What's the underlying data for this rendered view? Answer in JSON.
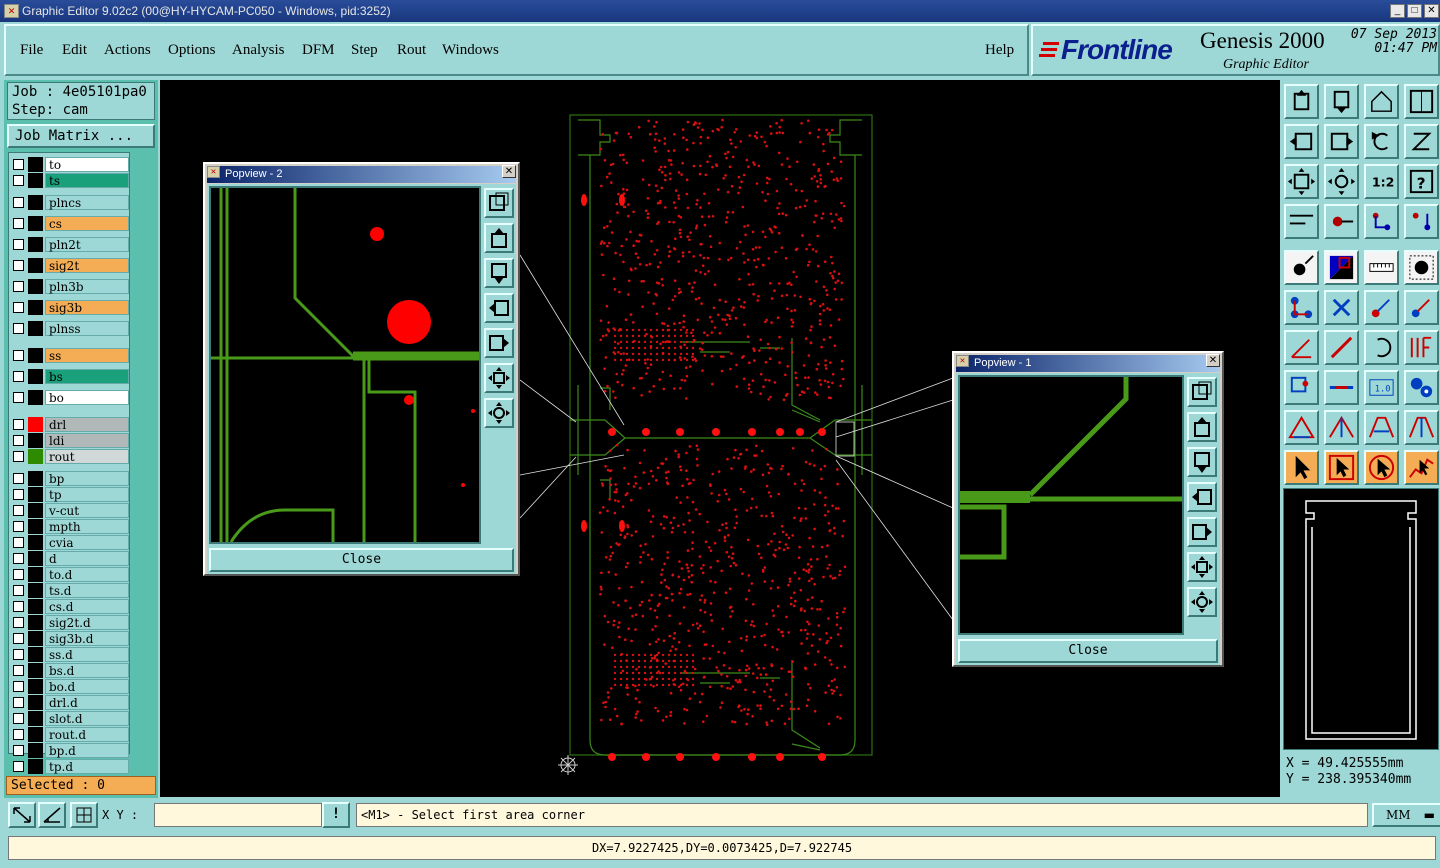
{
  "window": {
    "title": "Graphic Editor 9.02c2 (00@HY-HYCAM-PC050 - Windows, pid:3252)",
    "min_label": "_",
    "max_label": "□",
    "close_label": "✕"
  },
  "menu": [
    "File",
    "Edit",
    "Actions",
    "Options",
    "Analysis",
    "DFM",
    "Step",
    "Rout",
    "Windows"
  ],
  "help_label": "Help",
  "logo": {
    "brand": "Frontline",
    "product": "Genesis 2000",
    "subtitle": "Graphic Editor",
    "date": "07 Sep 2013",
    "time": "01:47 PM"
  },
  "job": {
    "job_line": "Job : 4e05101pa0",
    "step_line": "Step: cam",
    "matrix_label": "Job Matrix ..."
  },
  "layers": [
    {
      "name": "to",
      "color": "#ffffff",
      "swatch": "#000000",
      "group": 1
    },
    {
      "name": "ts",
      "color": "#1aa07a",
      "swatch": "#000000",
      "group": 1
    },
    {
      "name": "plncs",
      "color": "#9ed8d6",
      "swatch": "#000000",
      "group": 2
    },
    {
      "name": "cs",
      "color": "#f4ac55",
      "swatch": "#000000",
      "group": 2
    },
    {
      "name": "pln2t",
      "color": "#9ed8d6",
      "swatch": "#000000",
      "group": 2
    },
    {
      "name": "sig2t",
      "color": "#f4ac55",
      "swatch": "#000000",
      "group": 2
    },
    {
      "name": "pln3b",
      "color": "#9ed8d6",
      "swatch": "#000000",
      "group": 2
    },
    {
      "name": "sig3b",
      "color": "#f4ac55",
      "swatch": "#000000",
      "group": 2
    },
    {
      "name": "plnss",
      "color": "#9ed8d6",
      "swatch": "#000000",
      "group": 2
    },
    {
      "name": "ss",
      "color": "#f4ac55",
      "swatch": "#000000",
      "group": 3
    },
    {
      "name": "bs",
      "color": "#1aa07a",
      "swatch": "#000000",
      "group": 3
    },
    {
      "name": "bo",
      "color": "#ffffff",
      "swatch": "#000000",
      "group": 3
    },
    {
      "name": "drl",
      "color": "#b0b8b8",
      "swatch": "#ff0000",
      "group": 4
    },
    {
      "name": "ldi",
      "color": "#b0b8b8",
      "swatch": "#000000",
      "group": 4
    },
    {
      "name": "rout",
      "color": "#d0d8d8",
      "swatch": "#2e8b00",
      "group": 4
    },
    {
      "name": "bp",
      "color": "#9ed8d6",
      "swatch": "#000000",
      "group": 5
    },
    {
      "name": "tp",
      "color": "#9ed8d6",
      "swatch": "#000000",
      "group": 5
    },
    {
      "name": "v-cut",
      "color": "#9ed8d6",
      "swatch": "#000000",
      "group": 5
    },
    {
      "name": "mpth",
      "color": "#9ed8d6",
      "swatch": "#000000",
      "group": 5
    },
    {
      "name": "cvia",
      "color": "#9ed8d6",
      "swatch": "#000000",
      "group": 5
    },
    {
      "name": "d",
      "color": "#9ed8d6",
      "swatch": "#000000",
      "group": 5
    },
    {
      "name": "to.d",
      "color": "#9ed8d6",
      "swatch": "#000000",
      "group": 5
    },
    {
      "name": "ts.d",
      "color": "#9ed8d6",
      "swatch": "#000000",
      "group": 5
    },
    {
      "name": "cs.d",
      "color": "#9ed8d6",
      "swatch": "#000000",
      "group": 5
    },
    {
      "name": "sig2t.d",
      "color": "#9ed8d6",
      "swatch": "#000000",
      "group": 5
    },
    {
      "name": "sig3b.d",
      "color": "#9ed8d6",
      "swatch": "#000000",
      "group": 5
    },
    {
      "name": "ss.d",
      "color": "#9ed8d6",
      "swatch": "#000000",
      "group": 5
    },
    {
      "name": "bs.d",
      "color": "#9ed8d6",
      "swatch": "#000000",
      "group": 5
    },
    {
      "name": "bo.d",
      "color": "#9ed8d6",
      "swatch": "#000000",
      "group": 5
    },
    {
      "name": "drl.d",
      "color": "#9ed8d6",
      "swatch": "#000000",
      "group": 5
    },
    {
      "name": "slot.d",
      "color": "#9ed8d6",
      "swatch": "#000000",
      "group": 5
    },
    {
      "name": "rout.d",
      "color": "#9ed8d6",
      "swatch": "#000000",
      "group": 5
    },
    {
      "name": "bp.d",
      "color": "#9ed8d6",
      "swatch": "#000000",
      "group": 5
    },
    {
      "name": "tp.d",
      "color": "#9ed8d6",
      "swatch": "#000000",
      "group": 5
    }
  ],
  "selected_label": "Selected : 0",
  "popview2": {
    "title": "Popview - 2",
    "close": "Close"
  },
  "popview1": {
    "title": "Popview - 1",
    "close": "Close"
  },
  "coords": {
    "x": "X = 49.425555mm",
    "y": "Y = 238.395340mm"
  },
  "bottom": {
    "xy_label": "X Y :",
    "xy_value": "",
    "excl": "!",
    "prompt": "<M1> - Select first area corner",
    "units": "MM"
  },
  "status": "DX=7.9227425,DY=0.0073425,D=7.922745",
  "colors": {
    "panel": "#9ed8d6",
    "accent_orange": "#f4ac55",
    "drill_red": "#ff0000",
    "rout_green": "#4a9a1a"
  }
}
